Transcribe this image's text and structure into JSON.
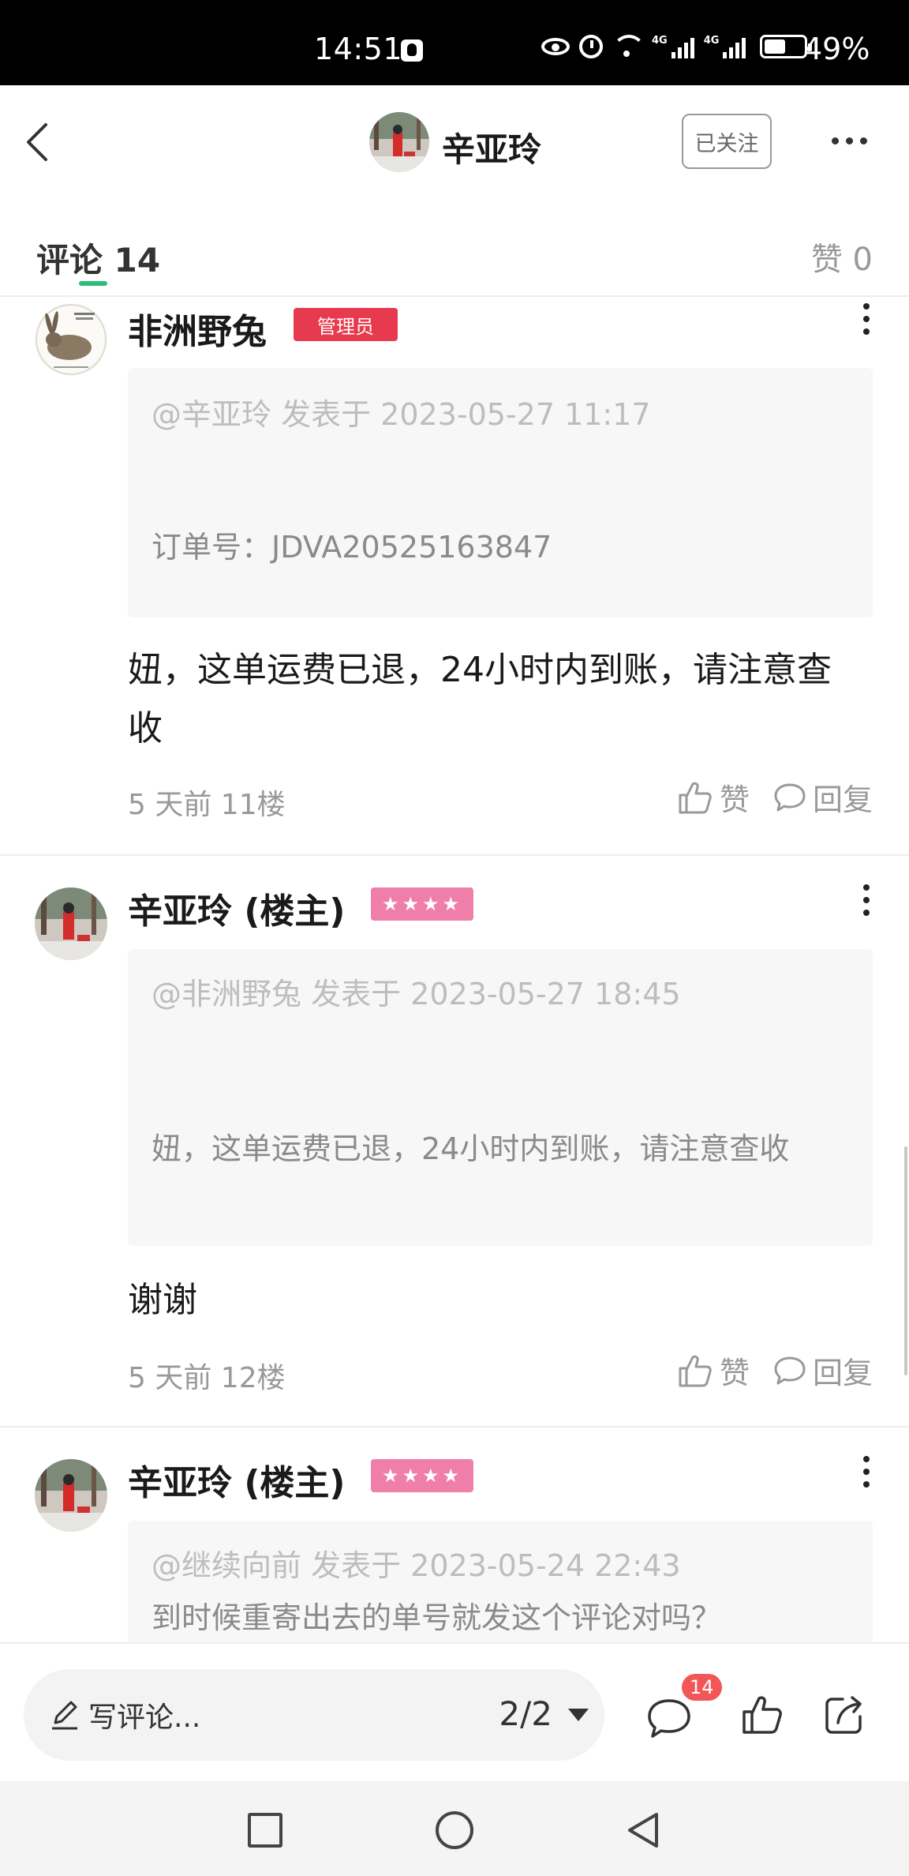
{
  "status_bar": {
    "time": "14:51",
    "battery": "49%",
    "network": "4G"
  },
  "header": {
    "title": "辛亚玲",
    "follow_label": "已关注"
  },
  "tabs": {
    "comments_label": "评论 14",
    "likes_label": "赞 0",
    "active_color": "#2bbf7a"
  },
  "comments": [
    {
      "author": "非洲野兔",
      "badge": "管理员",
      "badge_color": "#e83a4e",
      "quote_meta": "@辛亚玲 发表于 2023-05-27 11:17",
      "quote_text": "订单号：JDVA20525163847",
      "body": "妞，这单运费已退，24小时内到账，请注意查收",
      "meta": "5 天前  11楼",
      "like_label": "赞",
      "reply_label": "回复"
    },
    {
      "author": "辛亚玲 (楼主)",
      "badge": "★★★★",
      "badge_color": "#ef7fa8",
      "quote_meta": "@非洲野兔 发表于 2023-05-27 18:45",
      "quote_text": "妞，这单运费已退，24小时内到账，请注意查收",
      "body": "谢谢",
      "meta": "5 天前  12楼",
      "like_label": "赞",
      "reply_label": "回复"
    },
    {
      "author": "辛亚玲 (楼主)",
      "badge": "★★★★",
      "badge_color": "#ef7fa8",
      "quote_meta": "@继续向前 发表于 2023-05-24 22:43",
      "quote_text": "到时候重寄出去的单号就发这个评论对吗？"
    }
  ],
  "bottom_bar": {
    "placeholder": "写评论...",
    "page_indicator": "2/2",
    "comment_count": "14"
  },
  "icons": {
    "back": "back-icon",
    "more": "more-icon",
    "thumb": "thumb-up-icon",
    "bubble": "chat-bubble-icon",
    "pen": "pen-icon",
    "share": "share-icon"
  }
}
